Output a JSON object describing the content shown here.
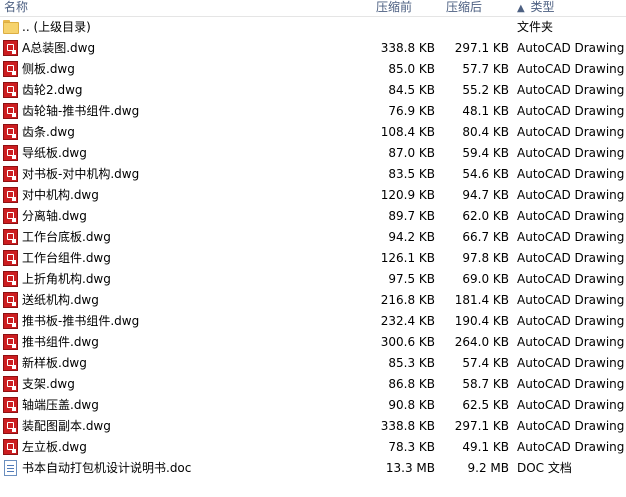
{
  "header": {
    "name": "名称",
    "packed": "压缩前",
    "size": "压缩后",
    "sort_arrow": "▲",
    "type": "类型"
  },
  "rows": [
    {
      "icon": "folder-icon",
      "name": ".. (上级目录)",
      "packed": "",
      "size": "",
      "type": "文件夹"
    },
    {
      "icon": "dwg-file-icon",
      "name": "A总装图.dwg",
      "packed": "338.8 KB",
      "size": "297.1 KB",
      "type": "AutoCAD Drawing"
    },
    {
      "icon": "dwg-file-icon",
      "name": "侧板.dwg",
      "packed": "85.0 KB",
      "size": "57.7 KB",
      "type": "AutoCAD Drawing"
    },
    {
      "icon": "dwg-file-icon",
      "name": "齿轮2.dwg",
      "packed": "84.5 KB",
      "size": "55.2 KB",
      "type": "AutoCAD Drawing"
    },
    {
      "icon": "dwg-file-icon",
      "name": "齿轮轴-推书组件.dwg",
      "packed": "76.9 KB",
      "size": "48.1 KB",
      "type": "AutoCAD Drawing"
    },
    {
      "icon": "dwg-file-icon",
      "name": "齿条.dwg",
      "packed": "108.4 KB",
      "size": "80.4 KB",
      "type": "AutoCAD Drawing"
    },
    {
      "icon": "dwg-file-icon",
      "name": "导纸板.dwg",
      "packed": "87.0 KB",
      "size": "59.4 KB",
      "type": "AutoCAD Drawing"
    },
    {
      "icon": "dwg-file-icon",
      "name": "对书板-对中机构.dwg",
      "packed": "83.5 KB",
      "size": "54.6 KB",
      "type": "AutoCAD Drawing"
    },
    {
      "icon": "dwg-file-icon",
      "name": "对中机构.dwg",
      "packed": "120.9 KB",
      "size": "94.7 KB",
      "type": "AutoCAD Drawing"
    },
    {
      "icon": "dwg-file-icon",
      "name": "分离轴.dwg",
      "packed": "89.7 KB",
      "size": "62.0 KB",
      "type": "AutoCAD Drawing"
    },
    {
      "icon": "dwg-file-icon",
      "name": "工作台底板.dwg",
      "packed": "94.2 KB",
      "size": "66.7 KB",
      "type": "AutoCAD Drawing"
    },
    {
      "icon": "dwg-file-icon",
      "name": "工作台组件.dwg",
      "packed": "126.1 KB",
      "size": "97.8 KB",
      "type": "AutoCAD Drawing"
    },
    {
      "icon": "dwg-file-icon",
      "name": "上折角机构.dwg",
      "packed": "97.5 KB",
      "size": "69.0 KB",
      "type": "AutoCAD Drawing"
    },
    {
      "icon": "dwg-file-icon",
      "name": "送纸机构.dwg",
      "packed": "216.8 KB",
      "size": "181.4 KB",
      "type": "AutoCAD Drawing"
    },
    {
      "icon": "dwg-file-icon",
      "name": "推书板-推书组件.dwg",
      "packed": "232.4 KB",
      "size": "190.4 KB",
      "type": "AutoCAD Drawing"
    },
    {
      "icon": "dwg-file-icon",
      "name": "推书组件.dwg",
      "packed": "300.6 KB",
      "size": "264.0 KB",
      "type": "AutoCAD Drawing"
    },
    {
      "icon": "dwg-file-icon",
      "name": "新样板.dwg",
      "packed": "85.3 KB",
      "size": "57.4 KB",
      "type": "AutoCAD Drawing"
    },
    {
      "icon": "dwg-file-icon",
      "name": "支架.dwg",
      "packed": "86.8 KB",
      "size": "58.7 KB",
      "type": "AutoCAD Drawing"
    },
    {
      "icon": "dwg-file-icon",
      "name": "轴端压盖.dwg",
      "packed": "90.8 KB",
      "size": "62.5 KB",
      "type": "AutoCAD Drawing"
    },
    {
      "icon": "dwg-file-icon",
      "name": "装配图副本.dwg",
      "packed": "338.8 KB",
      "size": "297.1 KB",
      "type": "AutoCAD Drawing"
    },
    {
      "icon": "dwg-file-icon",
      "name": "左立板.dwg",
      "packed": "78.3 KB",
      "size": "49.1 KB",
      "type": "AutoCAD Drawing"
    },
    {
      "icon": "doc-file-icon",
      "name": "书本自动打包机设计说明书.doc",
      "packed": "13.3 MB",
      "size": "9.2 MB",
      "type": "DOC 文档"
    }
  ]
}
